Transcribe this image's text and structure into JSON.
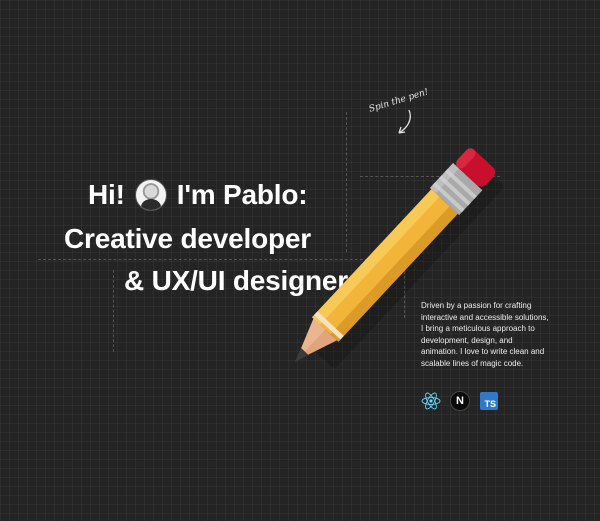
{
  "hero": {
    "greeting": "Hi!",
    "intro": "I'm Pablo:",
    "role_line1": "Creative developer",
    "role_line2": "& UX/UI designer"
  },
  "pencil_note": "Spin the pen!",
  "description": "Driven by a passion for crafting interactive and accessible solutions, I bring a meticulous approach to development, design, and animation. I love to write clean and scalable lines of magic code.",
  "tech_stack": {
    "icons": [
      "react-icon",
      "nextjs-icon",
      "typescript-icon"
    ],
    "next_letter": "N",
    "ts_label": "TS"
  },
  "colors": {
    "background": "#242424",
    "pencil_body": "#f2b53a",
    "pencil_eraser": "#c8102e",
    "react": "#61dafb",
    "typescript": "#3178c6"
  }
}
